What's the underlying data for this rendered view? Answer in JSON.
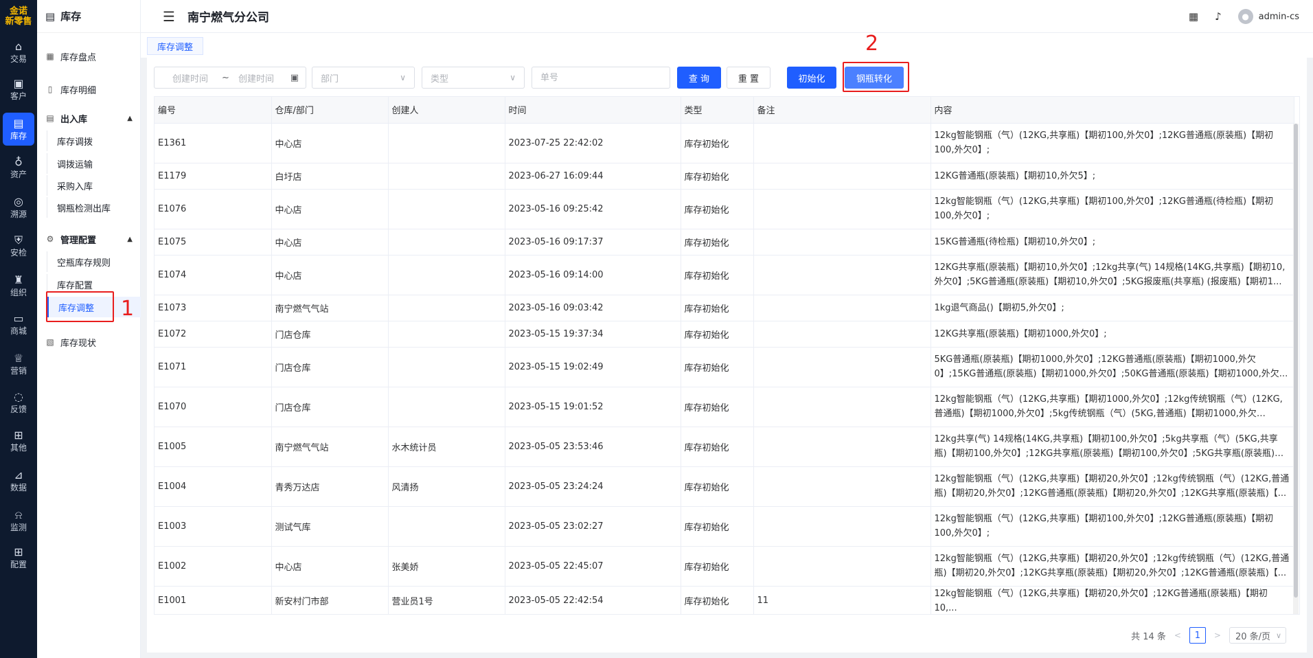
{
  "logo": {
    "line1": "金诺",
    "line2": "新零售"
  },
  "rail": [
    {
      "label": "交易",
      "icon": "bag-icon",
      "glyph": "⌂"
    },
    {
      "label": "客户",
      "icon": "id-card-icon",
      "glyph": "▣"
    },
    {
      "label": "库存",
      "icon": "inventory-icon",
      "glyph": "▤"
    },
    {
      "label": "资产",
      "icon": "bulb-icon",
      "glyph": "♁"
    },
    {
      "label": "溯源",
      "icon": "compass-icon",
      "glyph": "◎"
    },
    {
      "label": "安检",
      "icon": "shield-icon",
      "glyph": "⛨"
    },
    {
      "label": "组织",
      "icon": "org-chart-icon",
      "glyph": "♜"
    },
    {
      "label": "商城",
      "icon": "store-icon",
      "glyph": "▭"
    },
    {
      "label": "营销",
      "icon": "trophy-icon",
      "glyph": "♕"
    },
    {
      "label": "反馈",
      "icon": "chat-icon",
      "glyph": "◌"
    },
    {
      "label": "其他",
      "icon": "network-icon",
      "glyph": "⊞"
    },
    {
      "label": "数据",
      "icon": "chart-icon",
      "glyph": "⊿"
    },
    {
      "label": "监测",
      "icon": "alarm-icon",
      "glyph": "⍾"
    },
    {
      "label": "配置",
      "icon": "grid-icon",
      "glyph": "⊞"
    }
  ],
  "side": {
    "title": "库存",
    "inventory_check": "库存盘点",
    "inventory_detail": "库存明细",
    "group_inout": "出入库",
    "transfer": "库存调拨",
    "transport": "调拨运输",
    "purchase_in": "采购入库",
    "cylinder_out": "钢瓶检测出库",
    "group_manage": "管理配置",
    "empty_rule": "空瓶库存规则",
    "inv_config": "库存配置",
    "inv_adjust": "库存调整",
    "inv_status": "库存现状"
  },
  "header": {
    "company": "南宁燃气分公司",
    "user": "admin-cs"
  },
  "tabs": {
    "active": "库存调整"
  },
  "filters": {
    "date_start": "创建时间",
    "tilde": "~",
    "date_end": "创建时间",
    "dept": "部门",
    "type": "类型",
    "number": "单号",
    "query": "查 询",
    "reset": "重 置",
    "init": "初始化",
    "convert": "钢瓶转化"
  },
  "table": {
    "columns": [
      "编号",
      "仓库/部门",
      "创建人",
      "时间",
      "类型",
      "备注",
      "内容"
    ],
    "rows": [
      [
        "E1361",
        "中心店",
        "",
        "2023-07-25 22:42:02",
        "库存初始化",
        "",
        "12kg智能钢瓶（气）(12KG,共享瓶)【期初100,外欠0】;12KG普通瓶(原装瓶)【期初100,外欠0】;"
      ],
      [
        "E1179",
        "白圩店",
        "",
        "2023-06-27 16:09:44",
        "库存初始化",
        "",
        "12KG普通瓶(原装瓶)【期初10,外欠5】;"
      ],
      [
        "E1076",
        "中心店",
        "",
        "2023-05-16 09:25:42",
        "库存初始化",
        "",
        "12kg智能钢瓶（气）(12KG,共享瓶)【期初100,外欠0】;12KG普通瓶(待检瓶)【期初100,外欠0】;"
      ],
      [
        "E1075",
        "中心店",
        "",
        "2023-05-16 09:17:37",
        "库存初始化",
        "",
        "15KG普通瓶(待检瓶)【期初10,外欠0】;"
      ],
      [
        "E1074",
        "中心店",
        "",
        "2023-05-16 09:14:00",
        "库存初始化",
        "",
        "12KG共享瓶(原装瓶)【期初10,外欠0】;12kg共享(气) 14规格(14KG,共享瓶)【期初10,外欠0】;5KG普通瓶(原装瓶)【期初10,外欠0】;5KG报废瓶(共享瓶) (报废瓶)【期初1..."
      ],
      [
        "E1073",
        "南宁燃气气站",
        "",
        "2023-05-16 09:03:42",
        "库存初始化",
        "",
        "1kg退气商品()【期初5,外欠0】;"
      ],
      [
        "E1072",
        "门店仓库",
        "",
        "2023-05-15 19:37:34",
        "库存初始化",
        "",
        "12KG共享瓶(原装瓶)【期初1000,外欠0】;"
      ],
      [
        "E1071",
        "门店仓库",
        "",
        "2023-05-15 19:02:49",
        "库存初始化",
        "",
        "5KG普通瓶(原装瓶)【期初1000,外欠0】;12KG普通瓶(原装瓶)【期初1000,外欠0】;15KG普通瓶(原装瓶)【期初1000,外欠0】;50KG普通瓶(原装瓶)【期初1000,外欠..."
      ],
      [
        "E1070",
        "门店仓库",
        "",
        "2023-05-15 19:01:52",
        "库存初始化",
        "",
        "12kg智能钢瓶（气）(12KG,共享瓶)【期初1000,外欠0】;12kg传统钢瓶（气）(12KG,普通瓶)【期初1000,外欠0】;5kg传统钢瓶（气）(5KG,普通瓶)【期初1000,外欠0】;12k..."
      ],
      [
        "E1005",
        "南宁燃气气站",
        "水木统计员",
        "2023-05-05 23:53:46",
        "库存初始化",
        "",
        "12kg共享(气) 14规格(14KG,共享瓶)【期初100,外欠0】;5kg共享瓶（气）(5KG,共享瓶)【期初100,外欠0】;12KG共享瓶(原装瓶)【期初100,外欠0】;5KG共享瓶(原装瓶)【期..."
      ],
      [
        "E1004",
        "青秀万达店",
        "风清扬",
        "2023-05-05 23:24:24",
        "库存初始化",
        "",
        "12kg智能钢瓶（气）(12KG,共享瓶)【期初20,外欠0】;12kg传统钢瓶（气）(12KG,普通瓶)【期初20,外欠0】;12KG普通瓶(原装瓶)【期初20,外欠0】;12KG共享瓶(原装瓶)【..."
      ],
      [
        "E1003",
        "测试气库",
        "",
        "2023-05-05 23:02:27",
        "库存初始化",
        "",
        "12kg智能钢瓶（气）(12KG,共享瓶)【期初100,外欠0】;12KG普通瓶(原装瓶)【期初100,外欠0】;"
      ],
      [
        "E1002",
        "中心店",
        "张美娇",
        "2023-05-05 22:45:07",
        "库存初始化",
        "",
        "12kg智能钢瓶（气）(12KG,共享瓶)【期初20,外欠0】;12kg传统钢瓶（气）(12KG,普通瓶)【期初20,外欠0】;12KG共享瓶(原装瓶)【期初20,外欠0】;12KG普通瓶(原装瓶)【..."
      ],
      [
        "E1001",
        "新安村门市部",
        "营业员1号",
        "2023-05-05 22:42:54",
        "库存初始化",
        "11",
        "12kg智能钢瓶（气）(12KG,共享瓶)【期初20,外欠0】;12KG普通瓶(原装瓶)【期初10,..."
      ]
    ]
  },
  "pager": {
    "total": "共 14 条",
    "page": "1",
    "size": "20 条/页"
  },
  "annotations": {
    "n1": "1",
    "n2": "2",
    "color": "#e81d1d"
  },
  "colors": {
    "accent": "#1f5eff",
    "rail_bg": "#0e1a2e",
    "logo": "#f5b700"
  }
}
